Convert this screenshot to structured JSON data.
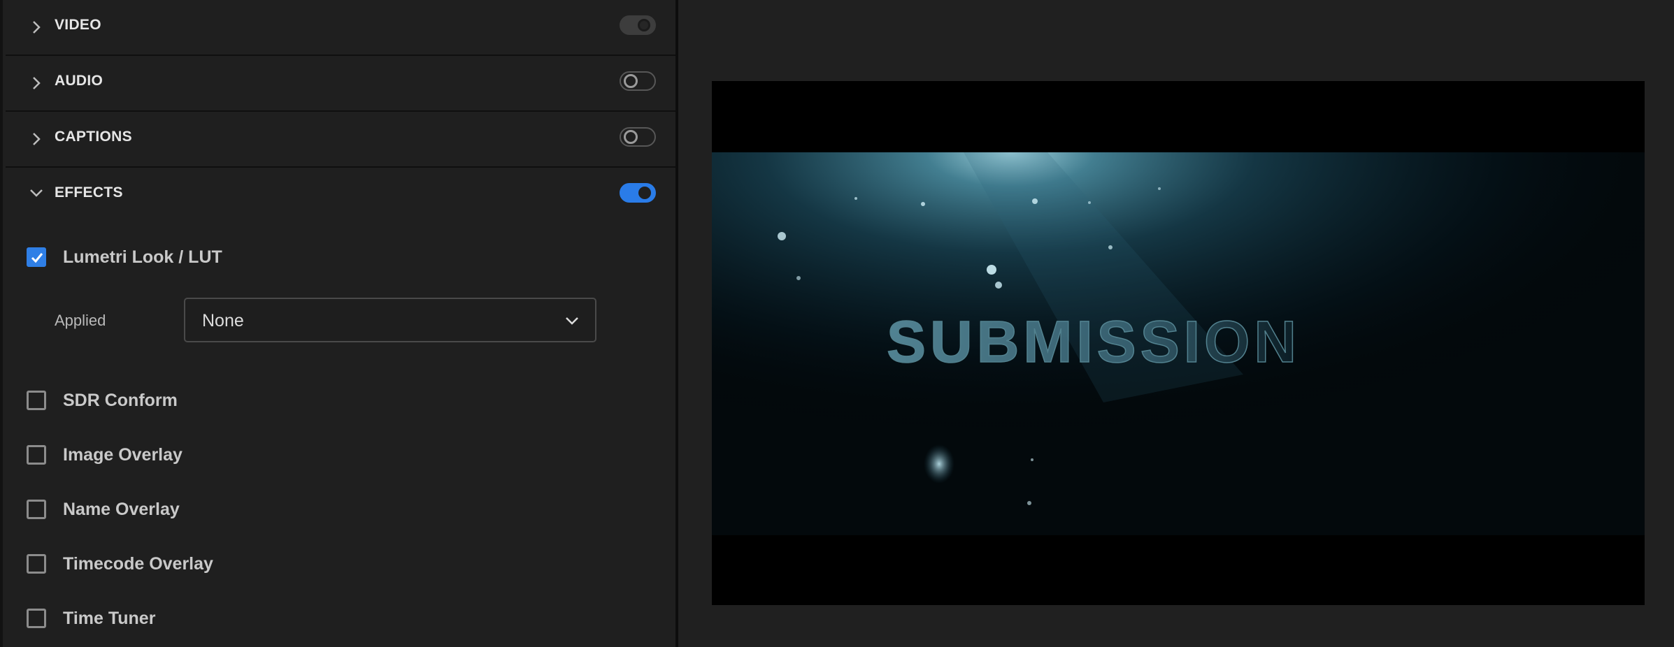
{
  "panel": {
    "sections": [
      {
        "id": "video",
        "title": "VIDEO",
        "expanded": false,
        "toggle": "locked-on"
      },
      {
        "id": "audio",
        "title": "AUDIO",
        "expanded": false,
        "toggle": "off"
      },
      {
        "id": "captions",
        "title": "CAPTIONS",
        "expanded": false,
        "toggle": "off"
      },
      {
        "id": "effects",
        "title": "EFFECTS",
        "expanded": true,
        "toggle": "on"
      }
    ],
    "effects": {
      "lumetri": {
        "label": "Lumetri Look / LUT",
        "checked": true
      },
      "applied_label": "Applied",
      "applied_value": "None",
      "items": [
        {
          "label": "SDR Conform",
          "checked": false
        },
        {
          "label": "Image Overlay",
          "checked": false
        },
        {
          "label": "Name Overlay",
          "checked": false
        },
        {
          "label": "Timecode Overlay",
          "checked": false
        },
        {
          "label": "Time Tuner",
          "checked": false
        }
      ]
    }
  },
  "viewer": {
    "frame_title_text": "SUBMISSION"
  },
  "colors": {
    "accent": "#2a7ce8",
    "panel_bg": "#1f1f1f",
    "frame_bg": "#000000"
  }
}
